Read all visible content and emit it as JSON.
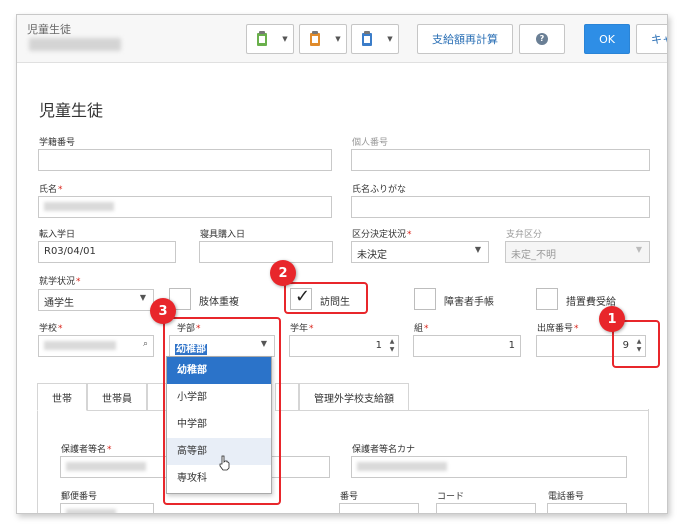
{
  "window": {
    "title": "児童生徒"
  },
  "toolbar": {
    "recalc_label": "支給額再計算",
    "ok_label": "OK",
    "cancel_label": "キャ"
  },
  "form": {
    "page_title": "児童生徒",
    "student_no_label": "学籍番号",
    "personal_no_label": "個人番号",
    "name_label": "氏名",
    "name_kana_label": "氏名ふりがな",
    "transfer_date_label": "転入学日",
    "transfer_date_value": "R03/04/01",
    "bedding_date_label": "寝具購入日",
    "classification_label": "区分決定状況",
    "classification_value": "未決定",
    "payment_class_label": "支弁区分",
    "payment_class_value": "未定_不明",
    "attendance_label": "就学状況",
    "attendance_value": "通学生",
    "cb_limb": "肢体重複",
    "cb_visit": "訪問生",
    "cb_disability": "障害者手帳",
    "cb_measure": "措置費受給",
    "school_label": "学校",
    "dept_label": "学部",
    "dept_value": "幼稚部",
    "grade_label": "学年",
    "grade_value": "1",
    "class_label": "組",
    "class_value": "1",
    "attend_no_label": "出席番号",
    "attend_no_value": "9"
  },
  "dropdown": {
    "options": [
      "幼稚部",
      "小学部",
      "中学部",
      "高等部",
      "専攻科"
    ]
  },
  "tabs": {
    "t1": "世帯",
    "t2": "世帯員",
    "t5": "管理外学校支給額"
  },
  "household": {
    "guardian_label": "保護者等名",
    "guardian_kana_label": "保護者等名カナ",
    "postal_label": "郵便番号",
    "number_label": "番号",
    "code_label": "コード",
    "phone_label": "電話番号"
  },
  "badges": {
    "b1": "1",
    "b2": "2",
    "b3": "3"
  },
  "colors": {
    "accent": "#2e8ee6",
    "callout": "#e8262b",
    "selection": "#2b73c9"
  }
}
